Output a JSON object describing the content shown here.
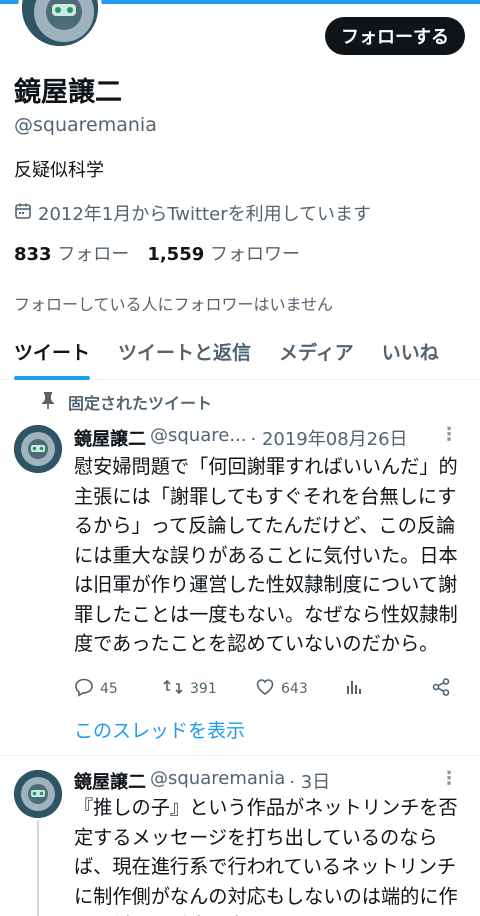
{
  "profile": {
    "display_name": "鏡屋譲二",
    "handle": "@squaremania",
    "bio": "反疑似科学",
    "joined": "2012年1月からTwitterを利用しています",
    "following_count": "833",
    "following_label": "フォロー",
    "followers_count": "1,559",
    "followers_label": "フォロワー",
    "mutual_note": "フォローしている人にフォロワーはいません",
    "follow_button": "フォローする"
  },
  "tabs": [
    {
      "label": "ツイート",
      "active": true
    },
    {
      "label": "ツイートと返信",
      "active": false
    },
    {
      "label": "メディア",
      "active": false
    },
    {
      "label": "いいね",
      "active": false
    }
  ],
  "pinned_label": "固定されたツイート",
  "tweets": [
    {
      "name": "鏡屋譲二",
      "handle": "@square...",
      "date": "· 2019年08月26日",
      "body": "慰安婦問題で「何回謝罪すればいいんだ」的主張には「謝罪してもすぐそれを台無しにするから」って反論してたんだけど、この反論には重大な誤りがあることに気付いた。日本は旧軍が作り運営した性奴隷制度について謝罪したことは一度もない。なぜなら性奴隷制度であったことを認めていないのだから。",
      "replies": "45",
      "retweets": "391",
      "likes": "643",
      "thread_link": "このスレッドを表示"
    },
    {
      "name": "鏡屋譲二",
      "handle": "@squaremania",
      "date": "· 3日",
      "body": "『推しの子』という作品がネットリンチを否定するメッセージを打ち出しているのならば、現在進行系で行われているネットリンチに制作側がなんの対応もしないのは端的に作品に対する重大な裏切りではないで"
    }
  ],
  "colors": {
    "accent": "#1d9bf0",
    "text": "#0f1419",
    "muted": "#536471"
  }
}
